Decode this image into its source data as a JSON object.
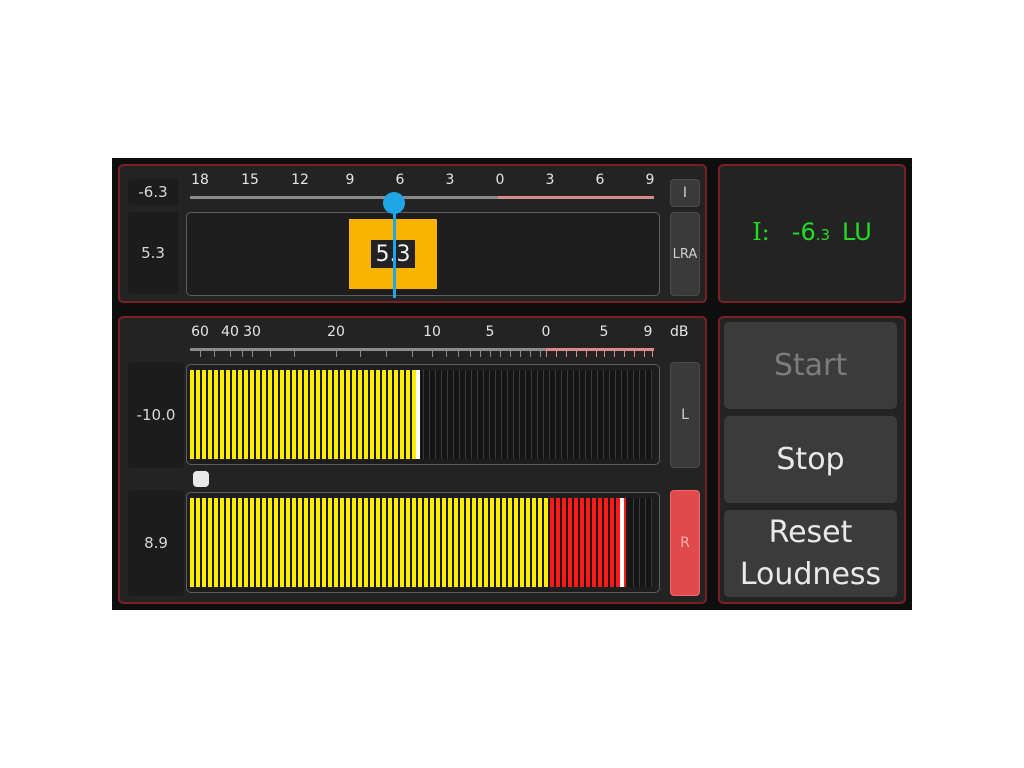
{
  "colors": {
    "panel_border": "#7a1f24",
    "meter_yellow": "#ffee00",
    "meter_red": "#ff1a1a",
    "lra_box": "#f8b400",
    "lra_marker": "#1fa6e6",
    "integrated_text": "#22dd22",
    "r_button": "#e04a4a"
  },
  "lra_panel": {
    "integrated_value": "-6.3",
    "lra_value": "5.3",
    "box_value": "5.3",
    "scale_labels": [
      "18",
      "15",
      "12",
      "9",
      "6",
      "3",
      "0",
      "3",
      "6",
      "9"
    ],
    "i_button_label": "I",
    "lra_button_label": "LRA",
    "marker_level": 6
  },
  "integrated_panel": {
    "prefix": "I:",
    "value_main": "-6",
    "value_decimal": ".3",
    "unit": "LU"
  },
  "level_panel": {
    "scale_labels": [
      "60",
      "40",
      "30",
      "20",
      "10",
      "5",
      "0",
      "5",
      "9"
    ],
    "unit_label": "dB",
    "left": {
      "value": "-10.0",
      "button_label": "L",
      "level_fraction": 0.49
    },
    "right": {
      "value": "8.9",
      "button_label": "R",
      "level_fraction": 0.94,
      "red_start_fraction": 0.775
    }
  },
  "buttons": {
    "start_label": "Start",
    "stop_label": "Stop",
    "reset_label_line1": "Reset",
    "reset_label_line2": "Loudness"
  }
}
